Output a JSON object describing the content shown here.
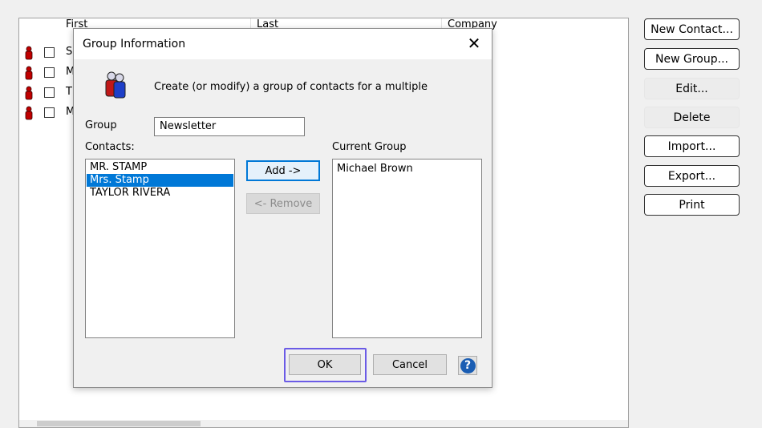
{
  "list": {
    "columns": [
      "First",
      "Last",
      "Company"
    ],
    "rows": [
      {
        "first": "S"
      },
      {
        "first": "M"
      },
      {
        "first": "T"
      },
      {
        "first": "M"
      }
    ]
  },
  "side_buttons": {
    "new_contact": "New Contact...",
    "new_group": "New Group...",
    "edit": "Edit...",
    "delete": "Delete",
    "import": "Import...",
    "export": "Export...",
    "print": "Print"
  },
  "dialog": {
    "title": "Group Information",
    "description": "Create (or modify) a group of contacts for a multiple",
    "group_label": "Group",
    "group_value": "Newsletter",
    "contacts_label": "Contacts:",
    "contacts": [
      "MR. STAMP",
      "Mrs. Stamp",
      "TAYLOR RIVERA"
    ],
    "selected_contact_index": 1,
    "current_group_label": "Current Group",
    "current_group": [
      "Michael Brown"
    ],
    "add_label": "Add ->",
    "remove_label": "<- Remove",
    "ok_label": "OK",
    "cancel_label": "Cancel",
    "close_glyph": "✕",
    "help_glyph": "?"
  },
  "colors": {
    "selection": "#0078d7",
    "focus_ring": "#6b5be6",
    "help": "#1a5db3"
  }
}
